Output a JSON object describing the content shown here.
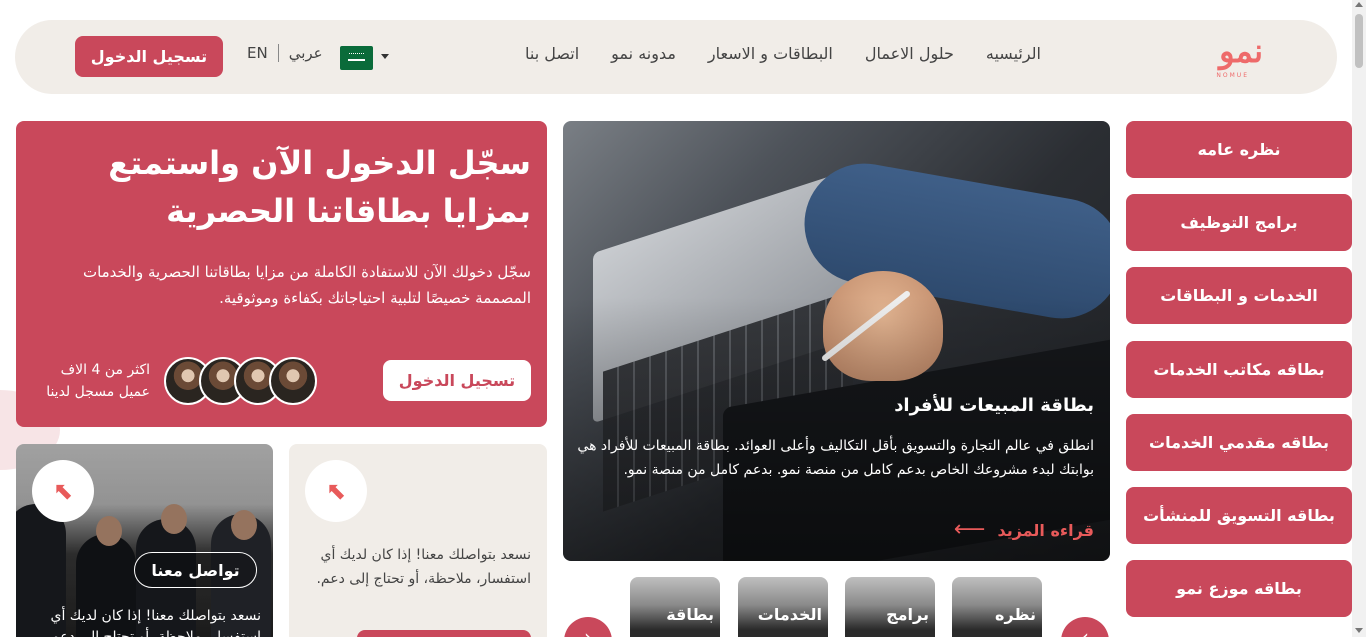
{
  "header": {
    "logo_text": "نمو",
    "logo_sub": "NOMUE",
    "nav": [
      "الرئيسيه",
      "حلول الاعمال",
      "البطاقات و الاسعار",
      "مدونه نمو",
      "اتصل بنا"
    ],
    "lang_ar": "عربي",
    "lang_en": "EN",
    "login_label": "تسجيل الدخول"
  },
  "hero": {
    "title": "سجّل الدخول الآن واستمتع بمزايا بطاقاتنا الحصرية",
    "text": "سجّل دخولك الآن للاستفادة الكاملة من مزايا بطاقاتنا الحصرية والخدمات المصممة خصيصًا لتلبية احتياجاتك بكفاءة وموثوقية.",
    "button": "تسجيل الدخول",
    "count_text": "اكثر من 4 الاف عميل مسجل لدينا"
  },
  "contact_card": {
    "pill": "تواصل معنا",
    "text": "نسعد بتواصلك معنا! إذا كان لديك أي استفسار، ملاحظة، أو تحتاج إلى دعم."
  },
  "info_card": {
    "text": "نسعد بتواصلك معنا! إذا كان لديك أي استفسار، ملاحظة، أو تحتاج إلى دعم."
  },
  "feature": {
    "title": "بطاقة المبيعات للأفراد",
    "text": "انطلق في عالم التجارة والتسويق بأقل التكاليف وأعلى العوائد. بطاقة المبيعات للأفراد هي بوابتك لبدء مشروعك الخاص بدعم كامل من منصة نمو. بدعم كامل من منصة نمو.",
    "read_more": "قراءه المزيد"
  },
  "thumbs": [
    "نظره",
    "برامج",
    "الخدمات",
    "بطاقة"
  ],
  "sidebar": [
    "نظره عامه",
    "برامج التوظيف",
    "الخدمات و البطاقات",
    "بطاقه مكاتب الخدمات",
    "بطاقه مقدمي الخدمات",
    "بطاقه التسويق للمنشأت",
    "بطاقه موزع نمو"
  ],
  "colors": {
    "brand": "#c9485b",
    "accent": "#e85a5a",
    "beige": "#f1ede8"
  },
  "icons": {
    "arrow_upleft": "arrow-up-left-icon",
    "arrow_left": "arrow-left-icon"
  }
}
